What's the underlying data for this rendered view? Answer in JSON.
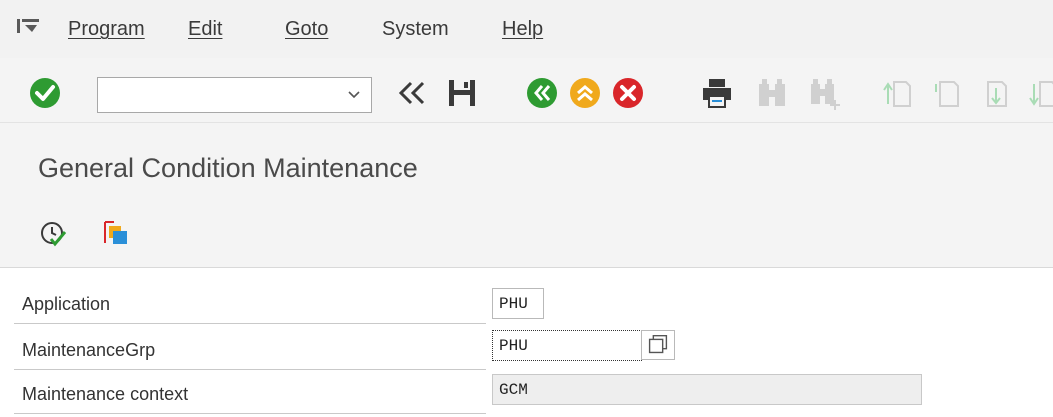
{
  "menubar": {
    "icon": "menu-icon",
    "items": [
      {
        "label": "Program"
      },
      {
        "label": "Edit"
      },
      {
        "label": "Goto"
      },
      {
        "label": "System"
      },
      {
        "label": "Help"
      }
    ]
  },
  "toolbar": {
    "command_field": {
      "value": "",
      "placeholder": ""
    },
    "buttons": [
      "enter-checkmark-icon",
      "back-double-chevron-icon",
      "save-icon",
      "back-green-icon",
      "exit-yellow-icon",
      "cancel-red-icon",
      "print-icon",
      "find-binoculars-icon",
      "find-next-binoculars-icon",
      "first-page-icon",
      "previous-page-icon",
      "next-page-icon",
      "last-page-icon"
    ],
    "colors": {
      "green": "#2e9b32",
      "yellow": "#f0a91c",
      "red": "#d9262a",
      "gray": "#3a3a3a",
      "disabled": "#d0d0d0",
      "disabled_green": "#a9dcb5"
    }
  },
  "title": "General Condition Maintenance",
  "app_toolbar": {
    "buttons": [
      "execute-clock-check-icon",
      "other-view-icon"
    ]
  },
  "form": {
    "fields": [
      {
        "label": "Application",
        "value": "PHU"
      },
      {
        "label": "MaintenanceGrp",
        "value": "PHU"
      },
      {
        "label": "Maintenance context",
        "value": "GCM"
      }
    ]
  }
}
